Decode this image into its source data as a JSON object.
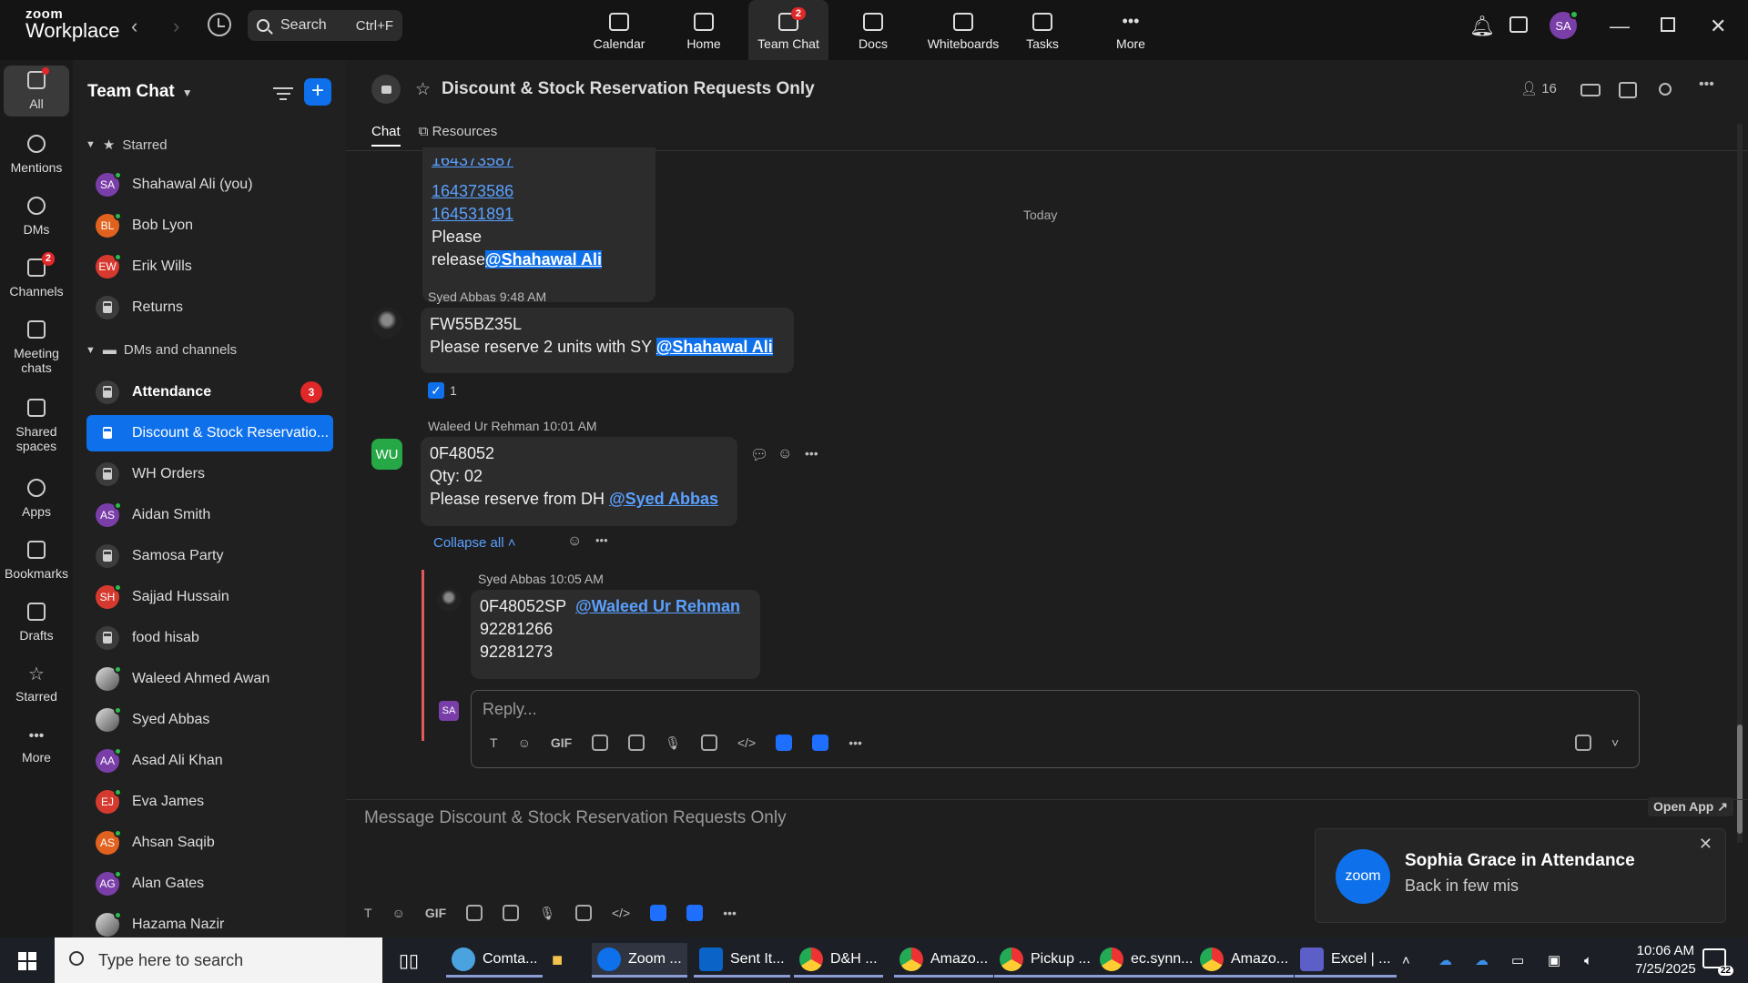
{
  "app": {
    "logo_line1": "zoom",
    "logo_line2": "Workplace"
  },
  "search": {
    "label": "Search",
    "shortcut": "Ctrl+F"
  },
  "topnav": [
    {
      "label": "Calendar",
      "badge": ""
    },
    {
      "label": "Home",
      "badge": ""
    },
    {
      "label": "Team Chat",
      "badge": "2"
    },
    {
      "label": "Docs",
      "badge": ""
    },
    {
      "label": "Whiteboards",
      "badge": ""
    },
    {
      "label": "Tasks",
      "badge": ""
    },
    {
      "label": "More",
      "badge": ""
    }
  ],
  "user": {
    "initials": "SA"
  },
  "rail": [
    {
      "label": "All"
    },
    {
      "label": "Mentions"
    },
    {
      "label": "DMs"
    },
    {
      "label": "Channels",
      "badge": "2"
    },
    {
      "label": "Meeting chats"
    },
    {
      "label": "Shared spaces"
    },
    {
      "label": "Apps"
    },
    {
      "label": "Bookmarks"
    },
    {
      "label": "Drafts"
    },
    {
      "label": "Starred"
    },
    {
      "label": "More"
    }
  ],
  "sidebar": {
    "title": "Team Chat",
    "starred_label": "Starred",
    "dms_label": "DMs and channels",
    "starred": [
      {
        "name": "Shahawal Ali (you)",
        "initials": "SA",
        "color": "#7a3ea8",
        "type": "user"
      },
      {
        "name": "Bob Lyon",
        "initials": "BL",
        "color": "#e0621e",
        "type": "user"
      },
      {
        "name": "Erik Wills",
        "initials": "EW",
        "color": "#d63a2f",
        "type": "user"
      },
      {
        "name": "Returns",
        "type": "lock"
      }
    ],
    "channels": [
      {
        "name": "Attendance",
        "type": "lock",
        "badge": "3"
      },
      {
        "name": "Discount & Stock Reservatio...",
        "type": "lock"
      },
      {
        "name": "WH Orders",
        "type": "lock"
      },
      {
        "name": "Aidan Smith",
        "initials": "AS",
        "color": "#7a3ea8",
        "type": "user"
      },
      {
        "name": "Samosa Party",
        "type": "lock"
      },
      {
        "name": "Sajjad Hussain",
        "initials": "SH",
        "color": "#d63a2f",
        "type": "user"
      },
      {
        "name": "food hisab",
        "type": "lock"
      },
      {
        "name": "Waleed Ahmed Awan",
        "type": "photo"
      },
      {
        "name": "Syed Abbas",
        "type": "photo"
      },
      {
        "name": "Asad Ali Khan",
        "initials": "AA",
        "color": "#7a3ea8",
        "type": "user"
      },
      {
        "name": "Eva James",
        "initials": "EJ",
        "color": "#d63a2f",
        "type": "user"
      },
      {
        "name": "Ahsan Saqib",
        "initials": "AS",
        "color": "#e0621e",
        "type": "user"
      },
      {
        "name": "Alan Gates",
        "initials": "AG",
        "color": "#7a3ea8",
        "type": "user"
      },
      {
        "name": "Hazama Nazir",
        "type": "photo"
      }
    ]
  },
  "channel": {
    "title": "Discount & Stock Reservation Requests Only",
    "members": "16",
    "tab_chat": "Chat",
    "tab_resources": "Resources"
  },
  "messages": {
    "prev_partial": "164373587",
    "prev_line1": "164373586",
    "prev_line2": "164531891",
    "prev_text": "Please release",
    "prev_mention": "@Shahawal Ali",
    "today": "Today",
    "m1_sender": "Syed Abbas",
    "m1_time": "9:48 AM",
    "m1_line1": "FW55BZ35L",
    "m1_line2": "Please reserve 2 units with SY",
    "m1_mention": "@Shahawal Ali",
    "m1_reaction_count": "1",
    "m2_sender": "Waleed Ur Rehman",
    "m2_time": "10:01 AM",
    "m2_initials": "WU",
    "m2_line1": "0F48052",
    "m2_line2": "Qty: 02",
    "m2_line3": "Please reserve from DH",
    "m2_mention": "@Syed Abbas",
    "collapse_label": "Collapse all",
    "r1_sender": "Syed Abbas",
    "r1_time": "10:05 AM",
    "r1_line1": "0F48052SP",
    "r1_mention": "@Waleed Ur Rehman",
    "r1_line2": "92281266",
    "r1_line3": "92281273"
  },
  "reply": {
    "placeholder": "Reply..."
  },
  "compose": {
    "placeholder": "Message Discount & Stock Reservation Requests Only"
  },
  "toolbar": {
    "gif": "GIF"
  },
  "toast": {
    "open_app": "Open App ↗",
    "logo": "zoom",
    "title": "Sophia Grace in Attendance",
    "body": "Back in few mis"
  },
  "taskbar": {
    "search_placeholder": "Type here to search",
    "apps": [
      "Comta...",
      "Zoom ...",
      "Sent It...",
      "D&H ...",
      "Amazo...",
      "Pickup ...",
      "ec.synn...",
      "Amazo...",
      "Excel | ..."
    ],
    "time": "10:06 AM",
    "date": "7/25/2025",
    "notif_count": "22"
  }
}
